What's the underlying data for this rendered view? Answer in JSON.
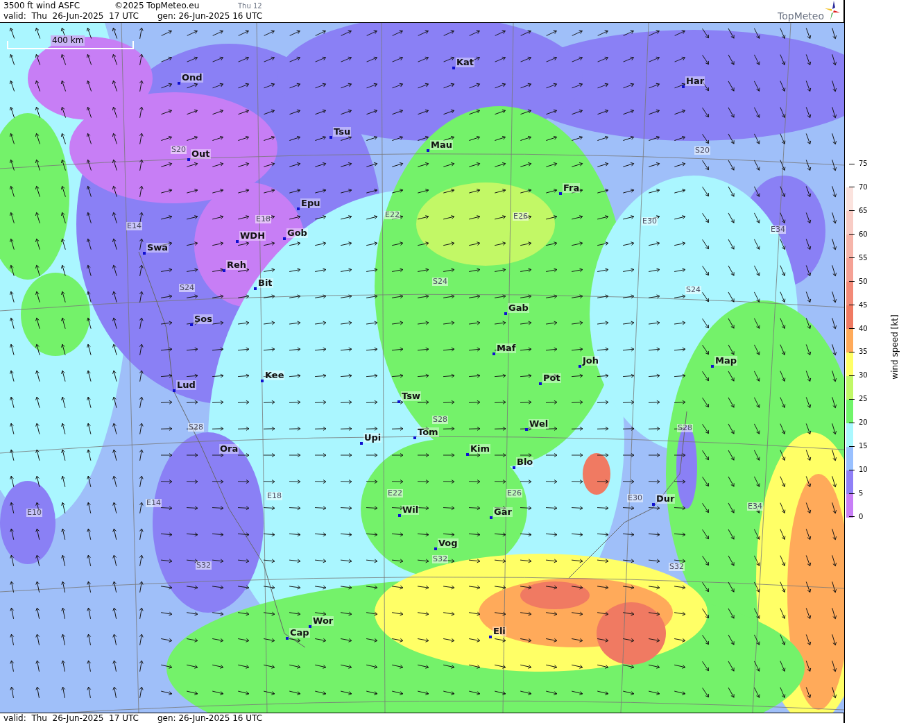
{
  "header": {
    "title": "3500 ft wind ASFC",
    "copyright": "©2025 TopMeteo.eu",
    "frame": "Thu 12",
    "valid": "valid:  Thu  26-Jun-2025  17 UTC",
    "generated": "gen: 26-Jun-2025 16 UTC",
    "logo": "TopMeteo"
  },
  "map": {
    "scale": "400 km",
    "cities": [
      {
        "name": "Ond"
      },
      {
        "name": "Kat"
      },
      {
        "name": "Har"
      },
      {
        "name": "Tsu"
      },
      {
        "name": "Mau"
      },
      {
        "name": "Out"
      },
      {
        "name": "Fra"
      },
      {
        "name": "Epu"
      },
      {
        "name": "Gob"
      },
      {
        "name": "WDH"
      },
      {
        "name": "Swa"
      },
      {
        "name": "Reh"
      },
      {
        "name": "Bit"
      },
      {
        "name": "Gab"
      },
      {
        "name": "Sos"
      },
      {
        "name": "Maf"
      },
      {
        "name": "Joh"
      },
      {
        "name": "Map"
      },
      {
        "name": "Kee"
      },
      {
        "name": "Pot"
      },
      {
        "name": "Lud"
      },
      {
        "name": "Tsw"
      },
      {
        "name": "Wel"
      },
      {
        "name": "Tom"
      },
      {
        "name": "Upi"
      },
      {
        "name": "Kim"
      },
      {
        "name": "Ora"
      },
      {
        "name": "Blo"
      },
      {
        "name": "Dur"
      },
      {
        "name": "Wil"
      },
      {
        "name": "Gar"
      },
      {
        "name": "Vog"
      },
      {
        "name": "Wor"
      },
      {
        "name": "Cap"
      },
      {
        "name": "Eli"
      }
    ],
    "grid_labels": [
      "S20",
      "S20",
      "E14",
      "E18",
      "E22",
      "E26",
      "E30",
      "E34",
      "S24",
      "S24",
      "S24",
      "S28",
      "S28",
      "S28",
      "E10",
      "E14",
      "E18",
      "E22",
      "E26",
      "E30",
      "E34",
      "S32",
      "S32",
      "S32"
    ]
  },
  "legend": {
    "title": "wind speed [kt]",
    "ticks": [
      "75",
      "70",
      "65",
      "60",
      "55",
      "50",
      "45",
      "40",
      "35",
      "30",
      "25",
      "20",
      "15",
      "10",
      "5",
      "0"
    ],
    "bands": [
      {
        "color": "#fbe3de"
      },
      {
        "color": "#f8ccc5"
      },
      {
        "color": "#f6b5aa"
      },
      {
        "color": "#f5a195"
      },
      {
        "color": "#f38a78"
      },
      {
        "color": "#f07a62"
      },
      {
        "color": "#ffaa5a"
      },
      {
        "color": "#ffff66"
      },
      {
        "color": "#c0f866"
      },
      {
        "color": "#70f56a"
      },
      {
        "color": "#aaf8ff"
      },
      {
        "color": "#99c0ff"
      },
      {
        "color": "#8f7ff7"
      },
      {
        "color": "#c87ef7"
      }
    ]
  },
  "footer": {
    "valid": "valid:  Thu  26-Jun-2025  17 UTC",
    "generated": "gen: 26-Jun-2025 16 UTC"
  }
}
